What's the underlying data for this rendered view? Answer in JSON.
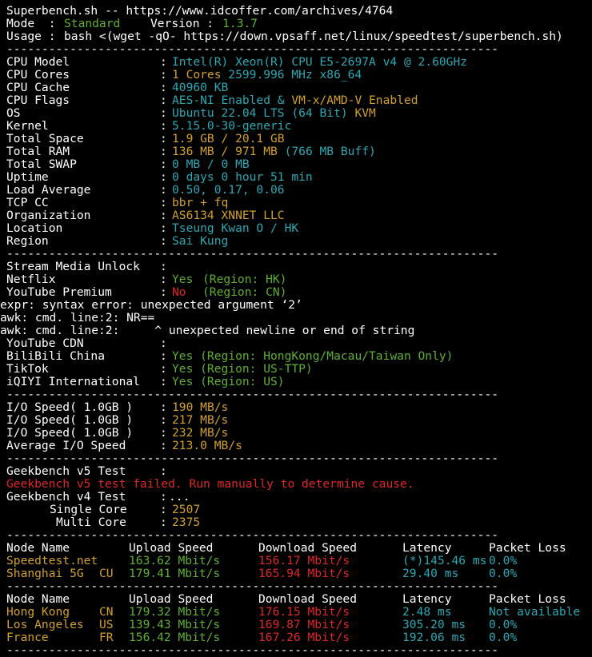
{
  "header": {
    "title_line": "Superbench.sh -- https://www.idcoffer.com/archives/4764",
    "mode_label": "Mode  : ",
    "mode_value": "Standard",
    "version_label": "Version : ",
    "version_value": "1.3.7",
    "usage_label": "Usage : ",
    "usage_cmd": "bash <(wget -qO- https://down.vpsaff.net/linux/speedtest/superbench.sh)"
  },
  "separator": "----------------------------------------------------------------------",
  "colon": ": ",
  "sysinfo": [
    {
      "label": "CPU Model",
      "parts": [
        {
          "text": "Intel(R) Xeon(R) CPU E5-2697A v4 @ 2.60GHz",
          "color": "cy"
        }
      ]
    },
    {
      "label": "CPU Cores",
      "parts": [
        {
          "text": "1 Cores ",
          "color": "y"
        },
        {
          "text": "2599.996 MHz x86_64",
          "color": "cy"
        }
      ]
    },
    {
      "label": "CPU Cache",
      "parts": [
        {
          "text": "40960 KB",
          "color": "cy"
        }
      ]
    },
    {
      "label": "CPU Flags",
      "parts": [
        {
          "text": "AES-NI Enabled & ",
          "color": "cy"
        },
        {
          "text": "VM-x/AMD-V Enabled",
          "color": "y"
        }
      ]
    },
    {
      "label": "OS",
      "parts": [
        {
          "text": "Ubuntu 22.04 LTS (64 Bit) ",
          "color": "cy"
        },
        {
          "text": "KVM",
          "color": "y"
        }
      ]
    },
    {
      "label": "Kernel",
      "parts": [
        {
          "text": "5.15.0-30-generic",
          "color": "cy"
        }
      ]
    },
    {
      "label": "Total Space",
      "parts": [
        {
          "text": "1.9 GB / ",
          "color": "y"
        },
        {
          "text": "20.1 GB",
          "color": "y"
        }
      ]
    },
    {
      "label": "Total RAM",
      "parts": [
        {
          "text": "136 MB / ",
          "color": "y"
        },
        {
          "text": "971 MB ",
          "color": "y"
        },
        {
          "text": "(766 MB Buff)",
          "color": "cy"
        }
      ]
    },
    {
      "label": "Total SWAP",
      "parts": [
        {
          "text": "0 MB / 0 MB",
          "color": "cy"
        }
      ]
    },
    {
      "label": "Uptime",
      "parts": [
        {
          "text": "0 days 0 hour 51 min",
          "color": "cy"
        }
      ]
    },
    {
      "label": "Load Average",
      "parts": [
        {
          "text": "0.50, 0.17, 0.06",
          "color": "cy"
        }
      ]
    },
    {
      "label": "TCP CC",
      "parts": [
        {
          "text": "bbr + fq",
          "color": "y"
        }
      ]
    },
    {
      "label": "Organization",
      "parts": [
        {
          "text": "AS6134 XNNET LLC",
          "color": "y"
        }
      ]
    },
    {
      "label": "Location",
      "parts": [
        {
          "text": "Tseung Kwan O / HK",
          "color": "cy"
        }
      ]
    },
    {
      "label": "Region",
      "parts": [
        {
          "text": "Sai Kung",
          "color": "cy"
        }
      ]
    }
  ],
  "stream": {
    "title": "Stream Media Unlock",
    "netflix_label": "Netflix",
    "netflix_status": "Yes",
    "netflix_region": "(Region: HK)",
    "youtube_label": "YouTube Premium",
    "youtube_status": "No ",
    "youtube_region": "(Region: CN)",
    "err1": "expr: syntax error: unexpected argument ‘2’",
    "err2": "awk: cmd. line:2: NR==",
    "err3": "awk: cmd. line:2:     ^ unexpected newline or end of string",
    "ytcdn_label": "YouTube CDN",
    "bili_label": "BiliBili China",
    "bili_value": "Yes (Region: HongKong/Macau/Taiwan Only)",
    "tiktok_label": "TikTok",
    "tiktok_value": "Yes (Region: US-TTP)",
    "iqiyi_label": "iQIYI International",
    "iqiyi_value": "Yes (Region: US)"
  },
  "io": [
    {
      "label": "I/O Speed( 1.0GB )",
      "value": "190",
      "unit": "MB/s"
    },
    {
      "label": "I/O Speed( 1.0GB )",
      "value": "217",
      "unit": "MB/s"
    },
    {
      "label": "I/O Speed( 1.0GB )",
      "value": "232",
      "unit": "MB/s"
    },
    {
      "label": "Average I/O Speed",
      "value": "213.0",
      "unit": "MB/s"
    }
  ],
  "geekbench": {
    "v5_label": "Geekbench v5 Test",
    "v5_error": "Geekbench v5 test failed. Run manually to determine cause.",
    "v4_label": "Geekbench v4 Test",
    "v4_value": "...",
    "single_label": "Single Core",
    "single_value": "2507",
    "multi_label": "Multi Core",
    "multi_value": "2375"
  },
  "speed_headers": {
    "node": "Node Name",
    "upload": "Upload Speed",
    "download": "Download Speed",
    "latency": "Latency",
    "loss": "Packet Loss"
  },
  "speed_table1": [
    {
      "node": "Speedtest.net",
      "cc": "",
      "upload": "163.62 Mbit/s",
      "download": "156.17 Mbit/s",
      "latency": "(*)145.46 ms",
      "loss": "0.0%"
    },
    {
      "node": "Shanghai 5G",
      "cc": "CU",
      "upload": "179.41 Mbit/s",
      "download": "165.94 Mbit/s",
      "latency": "29.40 ms",
      "loss": "0.0%"
    }
  ],
  "speed_table2": [
    {
      "node": "Hong Kong",
      "cc": "CN",
      "upload": "179.32 Mbit/s",
      "download": "176.15 Mbit/s",
      "latency": "2.48 ms",
      "loss": "Not available"
    },
    {
      "node": "Los Angeles",
      "cc": "US",
      "upload": "139.43 Mbit/s",
      "download": "169.87 Mbit/s",
      "latency": "305.20 ms",
      "loss": "0.0%"
    },
    {
      "node": "France",
      "cc": "FR",
      "upload": "156.42 Mbit/s",
      "download": "167.26 Mbit/s",
      "latency": "192.06 ms",
      "loss": "0.0%"
    }
  ],
  "colors": {
    "background": "#000000",
    "white": "#ffffff",
    "green": "#5fb02f",
    "yellow": "#d2a02a",
    "cyan": "#2aa8b3",
    "red": "#e02626"
  }
}
